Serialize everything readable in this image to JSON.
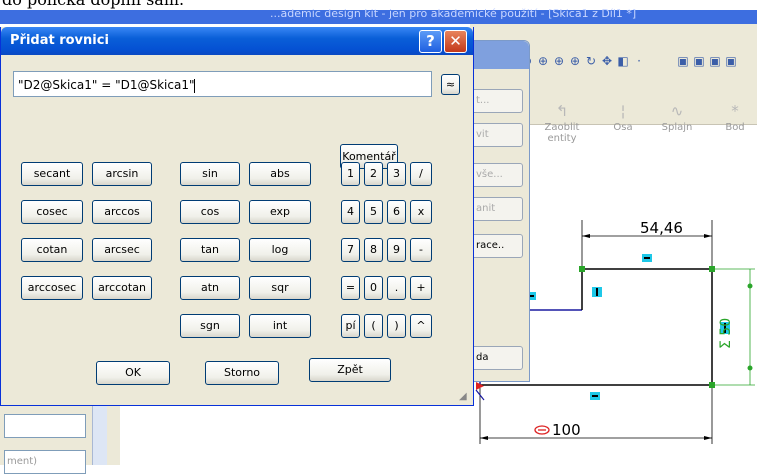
{
  "doc_caption": "do políčka doplní sám.",
  "sw_title": "...ademic design kit - jen pro akademické použití - [Skica1 z Díl1 *]",
  "dialog": {
    "title": "Přidat rovnici",
    "equation": "\"D2@Skica1\" = \"D1@Skica1\"",
    "expand_symbol": "≈",
    "comment_label": "Komentář",
    "functions_col1": [
      "secant",
      "cosec",
      "cotan",
      "arccosec"
    ],
    "functions_col2": [
      "arcsin",
      "arccos",
      "arcsec",
      "arccotan"
    ],
    "functions_col3": [
      "sin",
      "cos",
      "tan",
      "atn",
      "sgn"
    ],
    "functions_col4": [
      "abs",
      "exp",
      "log",
      "sqr",
      "int"
    ],
    "keypad": [
      [
        "1",
        "2",
        "3",
        "/"
      ],
      [
        "4",
        "5",
        "6",
        "x"
      ],
      [
        "7",
        "8",
        "9",
        "-"
      ],
      [
        "=",
        "0",
        ".",
        "+"
      ],
      [
        "pí",
        "(",
        ")",
        "^"
      ]
    ],
    "ok_label": "OK",
    "cancel_label": "Storno",
    "back_label": "Zpět"
  },
  "bg_dialog_buttons": [
    "t...",
    "vit",
    "vše...",
    "anit",
    "race..",
    "da"
  ],
  "sw_tools": [
    {
      "label": "Zaoblit\nentity",
      "icon": "fillet-icon"
    },
    {
      "label": "Osa",
      "icon": "axis-icon"
    },
    {
      "label": "Splajn",
      "icon": "spline-icon"
    },
    {
      "label": "Bod",
      "icon": "point-icon"
    }
  ],
  "dimensions": {
    "top": "54,46",
    "right": "Σ 50",
    "bottom": "100"
  },
  "left_panel_hint": "ment)"
}
